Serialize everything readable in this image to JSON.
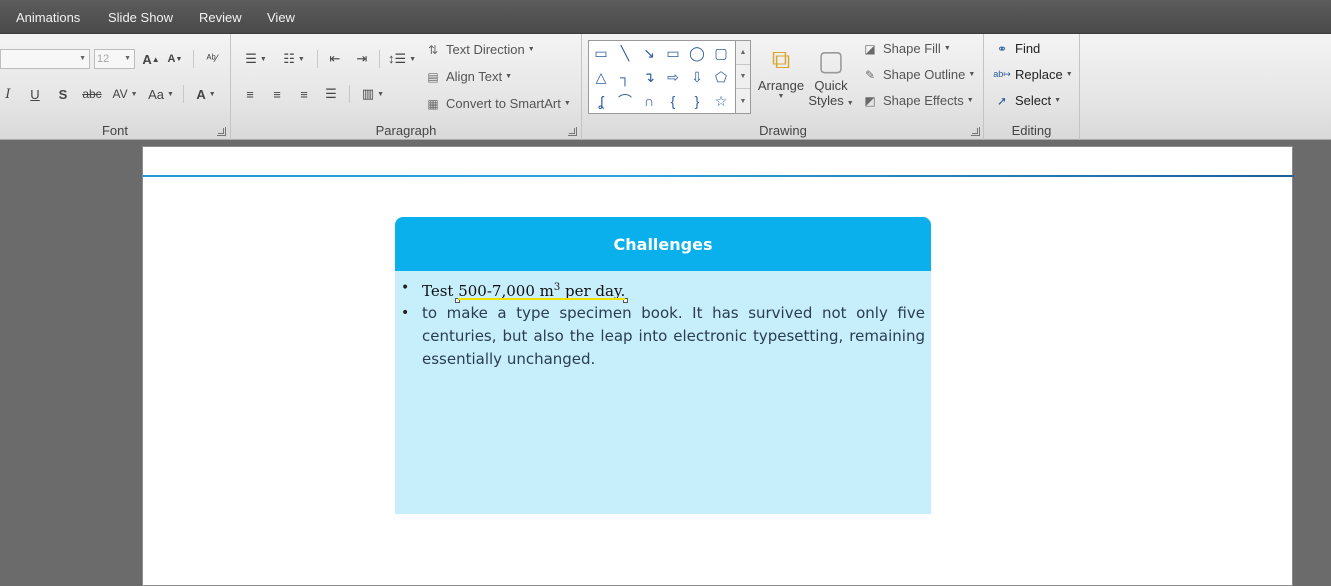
{
  "tabs": [
    {
      "label": "Animations"
    },
    {
      "label": "Slide Show"
    },
    {
      "label": "Review"
    },
    {
      "label": "View"
    }
  ],
  "ribbon": {
    "font_group": {
      "label": "Font",
      "font_size_value": "12"
    },
    "paragraph_group": {
      "label": "Paragraph",
      "text_direction": "Text Direction",
      "align_text": "Align Text",
      "convert_smartart": "Convert to SmartArt"
    },
    "drawing_group": {
      "label": "Drawing",
      "arrange": "Arrange",
      "quick_styles_line1": "Quick",
      "quick_styles_line2": "Styles",
      "shape_fill": "Shape Fill",
      "shape_outline": "Shape Outline",
      "shape_effects": "Shape Effects"
    },
    "editing_group": {
      "label": "Editing",
      "find": "Find",
      "replace": "Replace",
      "select": "Select"
    }
  },
  "slide": {
    "card_title": "Challenges",
    "bullet1": {
      "prefix": "Test ",
      "selected": "500-7,000 m",
      "superscript": "3",
      "suffix": " per day."
    },
    "bullet2": "to make a type specimen book. It has survived not only five centuries, but also the leap into electronic typesetting, remaining essentially unchanged."
  },
  "colors": {
    "card_header": "#0ab0ec",
    "card_body": "#c7eefb",
    "selection_underline": "#f0e000"
  }
}
